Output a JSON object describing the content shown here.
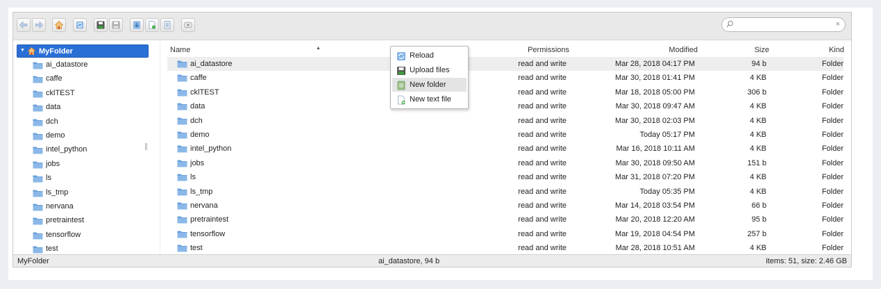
{
  "toolbar": {
    "buttons": [
      {
        "name": "back-button",
        "icon": "arrow-left-icon"
      },
      {
        "name": "forward-button",
        "icon": "arrow-right-icon"
      },
      {
        "name": "home-button",
        "icon": "home-icon"
      },
      {
        "name": "reload-button",
        "icon": "reload-icon"
      },
      {
        "name": "save-button",
        "icon": "save-icon"
      },
      {
        "name": "save-as-button",
        "icon": "save-disabled-icon"
      },
      {
        "name": "download-button",
        "icon": "download-icon"
      },
      {
        "name": "new-file-button",
        "icon": "new-file-icon"
      },
      {
        "name": "info-button",
        "icon": "info-icon"
      },
      {
        "name": "view-toggle-button",
        "icon": "view-icon"
      }
    ],
    "search": {
      "value": "",
      "placeholder": "",
      "clear_glyph": "×"
    }
  },
  "tree": {
    "root": {
      "label": "MyFolder",
      "expanded": true
    },
    "items": [
      "ai_datastore",
      "caffe",
      "cklTEST",
      "data",
      "dch",
      "demo",
      "intel_python",
      "jobs",
      "ls",
      "ls_tmp",
      "nervana",
      "pretraintest",
      "tensorflow",
      "test"
    ]
  },
  "table": {
    "columns": {
      "name": "Name",
      "permissions": "Permissions",
      "modified": "Modified",
      "size": "Size",
      "kind": "Kind"
    },
    "rows": [
      {
        "name": "ai_datastore",
        "permissions": "read and write",
        "modified": "Mar 28, 2018 04:17 PM",
        "size": "94 b",
        "kind": "Folder"
      },
      {
        "name": "caffe",
        "permissions": "read and write",
        "modified": "Mar 30, 2018 01:41 PM",
        "size": "4 KB",
        "kind": "Folder"
      },
      {
        "name": "cklTEST",
        "permissions": "read and write",
        "modified": "Mar 18, 2018 05:00 PM",
        "size": "306 b",
        "kind": "Folder"
      },
      {
        "name": "data",
        "permissions": "read and write",
        "modified": "Mar 30, 2018 09:47 AM",
        "size": "4 KB",
        "kind": "Folder"
      },
      {
        "name": "dch",
        "permissions": "read and write",
        "modified": "Mar 30, 2018 02:03 PM",
        "size": "4 KB",
        "kind": "Folder"
      },
      {
        "name": "demo",
        "permissions": "read and write",
        "modified": "Today 05:17 PM",
        "size": "4 KB",
        "kind": "Folder"
      },
      {
        "name": "intel_python",
        "permissions": "read and write",
        "modified": "Mar 16, 2018 10:11 AM",
        "size": "4 KB",
        "kind": "Folder"
      },
      {
        "name": "jobs",
        "permissions": "read and write",
        "modified": "Mar 30, 2018 09:50 AM",
        "size": "151 b",
        "kind": "Folder"
      },
      {
        "name": "ls",
        "permissions": "read and write",
        "modified": "Mar 31, 2018 07:20 PM",
        "size": "4 KB",
        "kind": "Folder"
      },
      {
        "name": "ls_tmp",
        "permissions": "read and write",
        "modified": "Today 05:35 PM",
        "size": "4 KB",
        "kind": "Folder"
      },
      {
        "name": "nervana",
        "permissions": "read and write",
        "modified": "Mar 14, 2018 03:54 PM",
        "size": "66 b",
        "kind": "Folder"
      },
      {
        "name": "pretraintest",
        "permissions": "read and write",
        "modified": "Mar 20, 2018 12:20 AM",
        "size": "95 b",
        "kind": "Folder"
      },
      {
        "name": "tensorflow",
        "permissions": "read and write",
        "modified": "Mar 19, 2018 04:54 PM",
        "size": "257 b",
        "kind": "Folder"
      },
      {
        "name": "test",
        "permissions": "read and write",
        "modified": "Mar 28, 2018 10:51 AM",
        "size": "4 KB",
        "kind": "Folder"
      }
    ]
  },
  "context_menu": {
    "items": [
      {
        "label": "Reload",
        "icon": "reload-icon"
      },
      {
        "label": "Upload files",
        "icon": "upload-icon"
      },
      {
        "label": "New folder",
        "icon": "new-folder-icon"
      },
      {
        "label": "New text file",
        "icon": "new-text-file-icon"
      }
    ]
  },
  "status": {
    "path": "MyFolder",
    "selection": "ai_datastore, 94 b",
    "summary": "items: 51, size: 2.46 GB"
  },
  "colors": {
    "selected_tree": "#2a6fd6",
    "folder_icon": "#6aa0dc",
    "row_selected": "#eeeeee"
  }
}
